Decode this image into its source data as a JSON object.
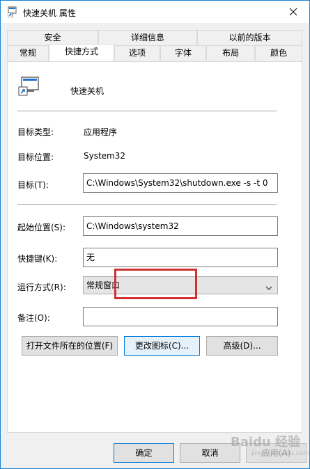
{
  "window": {
    "title": "快速关机 属性"
  },
  "tabs": {
    "row_back": [
      {
        "label": "安全"
      },
      {
        "label": "详细信息"
      },
      {
        "label": "以前的版本"
      }
    ],
    "row_front": [
      {
        "label": "常规"
      },
      {
        "label": "快捷方式"
      },
      {
        "label": "选项"
      },
      {
        "label": "字体"
      },
      {
        "label": "布局"
      },
      {
        "label": "颜色"
      }
    ],
    "active": "快捷方式"
  },
  "shortcut": {
    "name": "快速关机",
    "target_type_label": "目标类型:",
    "target_type_value": "应用程序",
    "target_location_label": "目标位置:",
    "target_location_value": "System32",
    "target_label": "目标(T):",
    "target_value": "C:\\Windows\\System32\\shutdown.exe -s -t 0",
    "start_in_label": "起始位置(S):",
    "start_in_value": "C:\\Windows\\system32",
    "hotkey_label": "快捷键(K):",
    "hotkey_value": "无",
    "run_label": "运行方式(R):",
    "run_value": "常规窗口",
    "comment_label": "备注(O):",
    "comment_value": ""
  },
  "buttons": {
    "open_location": "打开文件所在的位置(F)",
    "change_icon": "更改图标(C)...",
    "advanced": "高级(D)..."
  },
  "footer": {
    "ok": "确定",
    "cancel": "取消",
    "apply": "应用(A)"
  },
  "watermark": {
    "main": "Baidu 经验",
    "sub": "jingyan.baidu.com"
  },
  "colors": {
    "highlight": "#d32f2f",
    "focus": "#0078d7",
    "titlebar_border": "#1883d7"
  }
}
